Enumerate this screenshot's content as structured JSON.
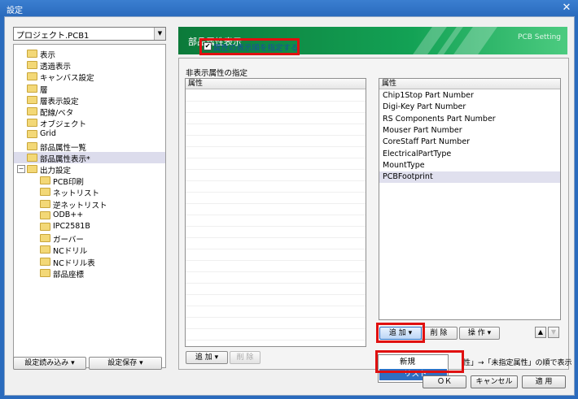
{
  "window": {
    "title": "設定",
    "close_glyph": "✕"
  },
  "left": {
    "project_select_value": "プロジェクト.PCB1",
    "tree": [
      {
        "label": "表示",
        "indent": 0
      },
      {
        "label": "透過表示",
        "indent": 0
      },
      {
        "label": "キャンバス設定",
        "indent": 0
      },
      {
        "label": "層",
        "indent": 0
      },
      {
        "label": "層表示設定",
        "indent": 0
      },
      {
        "label": "配線/ベタ",
        "indent": 0
      },
      {
        "label": "オブジェクト",
        "indent": 0
      },
      {
        "label": "Grid",
        "indent": 0
      },
      {
        "label": "部品属性一覧",
        "indent": 0
      },
      {
        "label": "部品属性表示*",
        "indent": 0,
        "selected": true
      },
      {
        "label": "出力設定",
        "indent": 0,
        "expander": "−"
      },
      {
        "label": "PCB印刷",
        "indent": 1
      },
      {
        "label": "ネットリスト",
        "indent": 1
      },
      {
        "label": "逆ネットリスト",
        "indent": 1
      },
      {
        "label": "ODB++",
        "indent": 1
      },
      {
        "label": "IPC2581B",
        "indent": 1
      },
      {
        "label": "ガーバー",
        "indent": 1
      },
      {
        "label": "NCドリル",
        "indent": 1
      },
      {
        "label": "NCドリル表",
        "indent": 1
      },
      {
        "label": "部品座標",
        "indent": 1
      }
    ],
    "load_button": "設定読み込み ▾",
    "save_button": "設定保存 ▾"
  },
  "header": {
    "title": "部品属性表示",
    "right_label": "PCB Setting"
  },
  "hidden_attrs": {
    "group_title": "非表示属性の指定",
    "column": "属性",
    "add_button": "追 加 ▾",
    "delete_button": "削 除"
  },
  "display_attrs": {
    "checkbox_label": "属性の表示順を指定する",
    "checkbox_checked": true,
    "check_glyph": "✔",
    "column": "属性",
    "items": [
      "Chip1Stop Part Number",
      "Digi-Key Part Number",
      "RS Components Part Number",
      "Mouser Part Number",
      "CoreStaff Part Number",
      "ElectricalPartType",
      "MountType",
      "PCBFootprint"
    ],
    "selected_index": 7,
    "add_button": "追 加 ▾",
    "delete_button": "削 除",
    "operate_button": "操 作 ▾",
    "up_glyph": "▲",
    "down_glyph": "▼",
    "hint_text": "性」→「未指定属性」の順で表示",
    "menu_items": [
      "新規",
      "リスト"
    ]
  },
  "footer": {
    "ok": "ＯＫ",
    "cancel": "キャンセル",
    "apply": "適 用"
  },
  "colors": {
    "header_green": "#13a255",
    "highlight_red": "#e01010",
    "menu_select": "#2f6fc2"
  }
}
